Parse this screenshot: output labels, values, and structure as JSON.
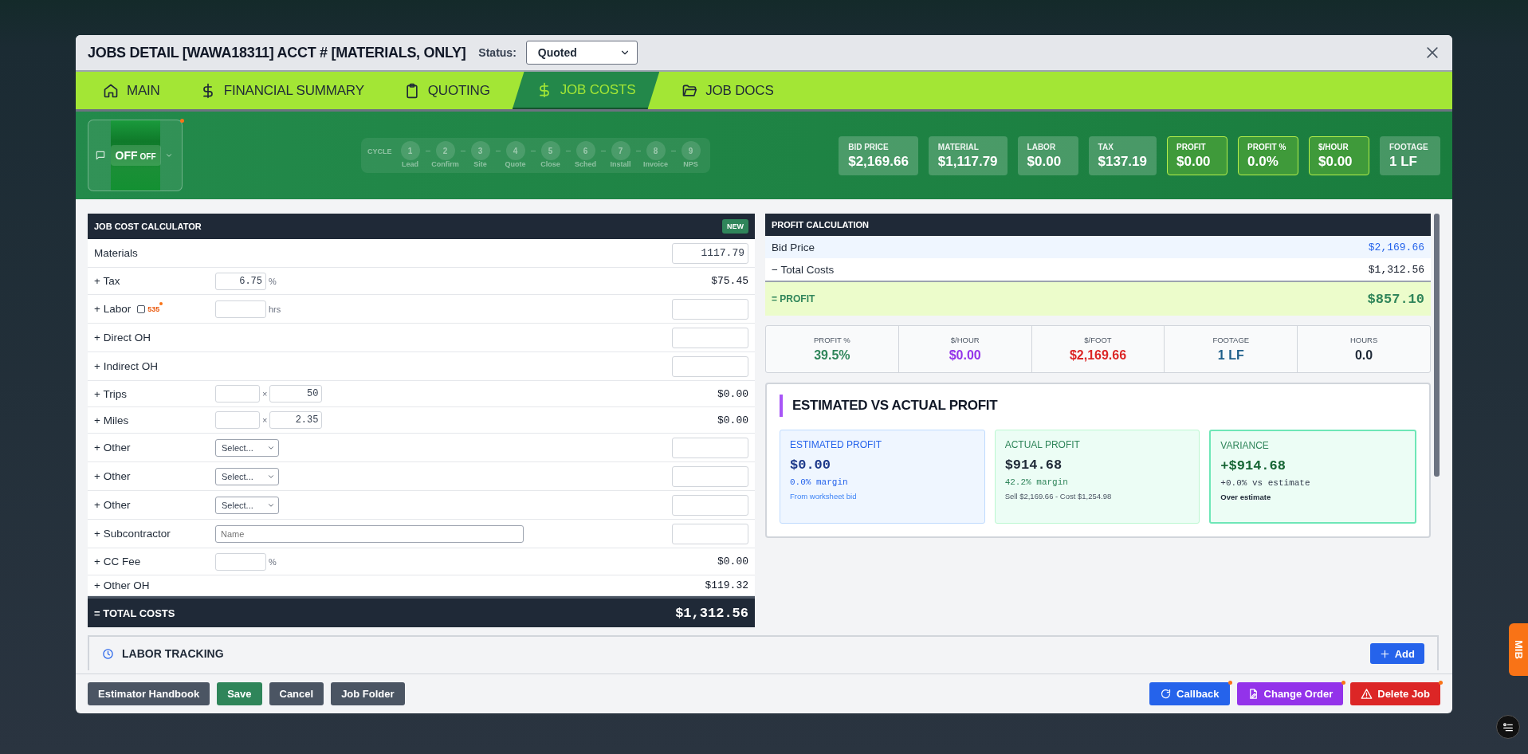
{
  "modal": {
    "title": "JOBS DETAIL [WAWA18311] ACCT # [MATERIALS, ONLY]",
    "status_label": "Status:",
    "status_value": "Quoted"
  },
  "tabs": [
    {
      "label": "MAIN",
      "selected": false
    },
    {
      "label": "FINANCIAL SUMMARY",
      "selected": false
    },
    {
      "label": "QUOTING",
      "selected": false
    },
    {
      "label": "JOB COSTS",
      "selected": true
    },
    {
      "label": "JOB DOCS",
      "selected": false
    }
  ],
  "toggle": {
    "label": "OFF",
    "sublabel": "OFF",
    "on": false,
    "notification": true
  },
  "cycle": {
    "label": "CYCLE",
    "steps": [
      {
        "number": "1",
        "label": "Lead"
      },
      {
        "number": "2",
        "label": "Confirm"
      },
      {
        "number": "3",
        "label": "Site"
      },
      {
        "number": "4",
        "label": "Quote"
      },
      {
        "number": "5",
        "label": "Close"
      },
      {
        "number": "6",
        "label": "Sched"
      },
      {
        "number": "7",
        "label": "Install"
      },
      {
        "number": "8",
        "label": "Invoice"
      },
      {
        "number": "9",
        "label": "NPS"
      }
    ]
  },
  "summary_cards": [
    {
      "label": "BID PRICE",
      "value": "$2,169.66",
      "highlighted": false
    },
    {
      "label": "MATERIAL",
      "value": "$1,117.79",
      "highlighted": false
    },
    {
      "label": "LABOR",
      "value": "$0.00",
      "highlighted": false
    },
    {
      "label": "TAX",
      "value": "$137.19",
      "highlighted": false
    },
    {
      "label": "PROFIT",
      "value": "$0.00",
      "highlighted": true
    },
    {
      "label": "PROFIT %",
      "value": "0.0%",
      "highlighted": true
    },
    {
      "label": "$/HOUR",
      "value": "$0.00",
      "highlighted": true
    },
    {
      "label": "FOOTAGE",
      "value": "1 LF",
      "highlighted": false
    }
  ],
  "calculator": {
    "title": "JOB COST CALCULATOR",
    "badge": "NEW",
    "rows": [
      {
        "kind": "amount_input",
        "label": "Materials",
        "value": "1117.79"
      },
      {
        "kind": "percent",
        "label": "+ Tax",
        "input": "6.75",
        "unit": "%",
        "amount": "$75.45"
      },
      {
        "kind": "hours",
        "label": "+ Labor",
        "checked": false,
        "badge": "535",
        "dot": true,
        "unit": "hrs"
      },
      {
        "kind": "amount_input",
        "label": "+ Direct OH"
      },
      {
        "kind": "amount_input",
        "label": "+ Indirect OH"
      },
      {
        "kind": "multiply",
        "label": "+ Trips",
        "sign": "×",
        "rate": "50",
        "amount": "$0.00"
      },
      {
        "kind": "multiply",
        "label": "+ Miles",
        "sign": "×",
        "rate": "2.35",
        "amount": "$0.00"
      },
      {
        "kind": "select",
        "label": "+ Other",
        "value": "Select..."
      },
      {
        "kind": "select",
        "label": "+ Other",
        "value": "Select..."
      },
      {
        "kind": "select",
        "label": "+ Other",
        "value": "Select..."
      },
      {
        "kind": "name",
        "label": "+ Subcontractor",
        "placeholder": "Name"
      },
      {
        "kind": "percent",
        "label": "+ CC Fee",
        "unit": "%",
        "amount": "$0.00"
      },
      {
        "kind": "amount",
        "label": "+ Other OH",
        "amount": "$119.32"
      }
    ],
    "total": {
      "label": "= TOTAL COSTS",
      "value": "$1,312.56"
    }
  },
  "profit": {
    "title": "PROFIT CALCULATION",
    "rows": [
      {
        "kind": "bid",
        "label": "Bid Price",
        "value": "$2,169.66"
      },
      {
        "kind": "cost",
        "label": "− Total Costs",
        "value": "$1,312.56"
      },
      {
        "kind": "profit",
        "label": "= PROFIT",
        "value": "$857.10"
      }
    ],
    "stats": [
      {
        "label": "PROFIT %",
        "value": "39.5%",
        "color": "#2f855a"
      },
      {
        "label": "$/HOUR",
        "value": "$0.00",
        "color": "#9333ea"
      },
      {
        "label": "$/FOOT",
        "value": "$2,169.66",
        "color": "#dc2626"
      },
      {
        "label": "FOOTAGE",
        "value": "1 LF",
        "color": "#1e5f8a"
      },
      {
        "label": "HOURS",
        "value": "0.0",
        "color": "#1f2937"
      }
    ]
  },
  "comparison": {
    "title": "ESTIMATED VS ACTUAL PROFIT",
    "cards": [
      {
        "kind": "estimated",
        "title": "ESTIMATED PROFIT",
        "value": "$0.00",
        "margin": "0.0% margin",
        "note": "From worksheet bid"
      },
      {
        "kind": "actual",
        "title": "ACTUAL PROFIT",
        "value": "$914.68",
        "margin": "42.2% margin",
        "note": "Sell $2,169.66 - Cost $1,254.98"
      },
      {
        "kind": "variance",
        "title": "VARIANCE",
        "value": "+$914.68",
        "margin": "+0.0% vs estimate",
        "note": "Over estimate"
      }
    ]
  },
  "labor_tracking": {
    "title": "LABOR TRACKING",
    "add": "Add"
  },
  "footer": {
    "left_buttons": [
      {
        "label": "Estimator Handbook",
        "kind": "neutral",
        "dot": false
      },
      {
        "label": "Save",
        "kind": "save",
        "dot": false
      },
      {
        "label": "Cancel",
        "kind": "neutral",
        "dot": false
      },
      {
        "label": "Job Folder",
        "kind": "neutral",
        "dot": false
      }
    ],
    "right_buttons": [
      {
        "label": "Callback",
        "kind": "callback",
        "dot": true
      },
      {
        "label": "Change Order",
        "kind": "change",
        "dot": true
      },
      {
        "label": "Delete Job",
        "kind": "delete",
        "dot": true
      }
    ]
  },
  "side_tab": {
    "label": "MIB"
  }
}
